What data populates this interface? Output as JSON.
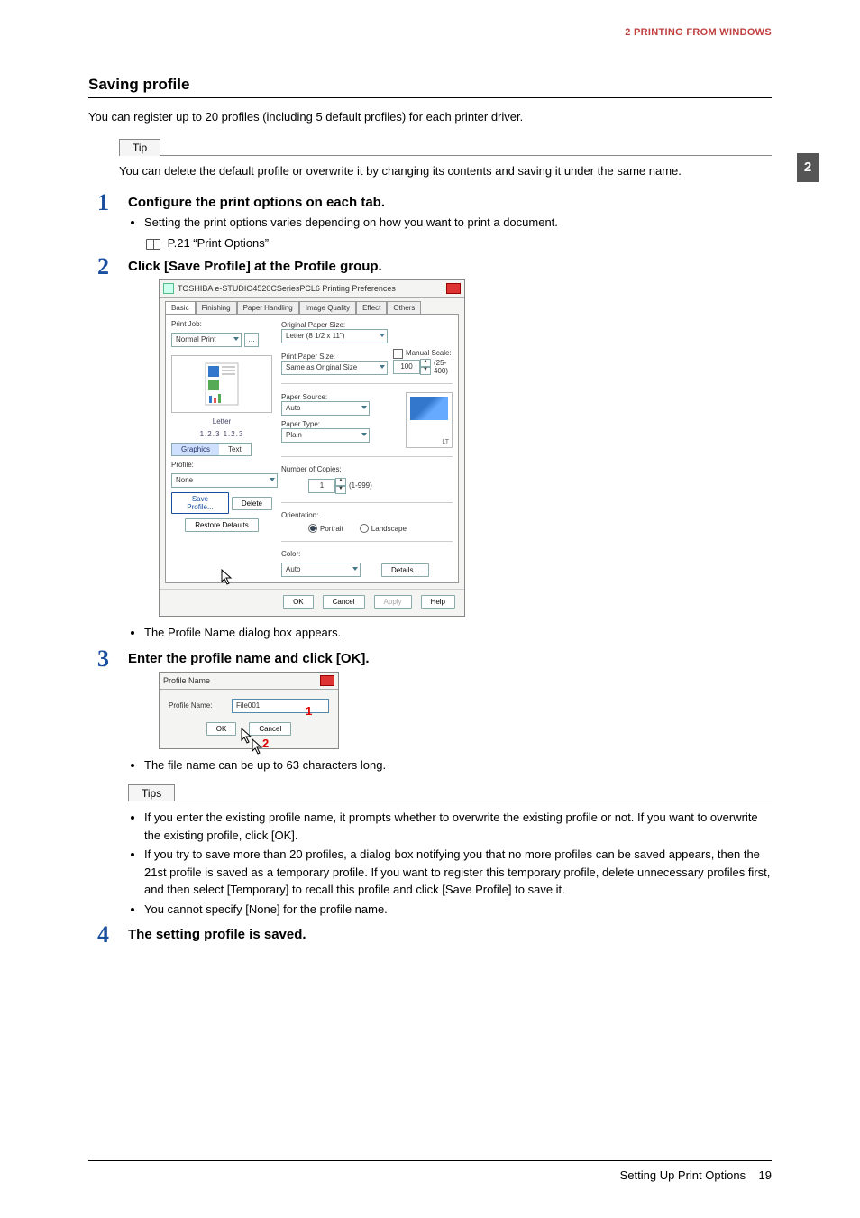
{
  "header": {
    "breadcrumb": "2 PRINTING FROM WINDOWS"
  },
  "thumb": "2",
  "section_title": "Saving profile",
  "intro": "You can register up to 20 profiles (including 5 default profiles) for each printer driver.",
  "tip": {
    "label": "Tip",
    "text": "You can delete the default profile or overwrite it by changing its contents and saving it under the same name."
  },
  "steps": {
    "s1": {
      "num": "1",
      "title": "Configure the print options on each tab.",
      "bullets": [
        "Setting the print options varies depending on how you want to print a document."
      ],
      "ref": "P.21 “Print Options”"
    },
    "s2": {
      "num": "2",
      "title": "Click [Save Profile] at the Profile group.",
      "note": "The Profile Name dialog box appears."
    },
    "s3": {
      "num": "3",
      "title": "Enter the profile name and click [OK].",
      "note": "The file name can be up to 63 characters long."
    },
    "s4": {
      "num": "4",
      "title": "The setting profile is saved."
    }
  },
  "tips2": {
    "label": "Tips",
    "items": [
      "If you enter the existing profile name, it prompts whether to overwrite the existing profile or not.  If you want to overwrite the existing profile, click [OK].",
      "If you try to save more than 20 profiles, a dialog box notifying you that no more profiles can be saved appears, then the 21st profile is saved as a temporary profile. If you want to register this temporary profile, delete unnecessary profiles first, and then select [Temporary] to recall this profile and click [Save Profile] to save it.",
      "You cannot specify [None] for the profile name."
    ]
  },
  "dlg1": {
    "title": "TOSHIBA e-STUDIO4520CSeriesPCL6 Printing Preferences",
    "tabs": [
      "Basic",
      "Finishing",
      "Paper Handling",
      "Image Quality",
      "Effect",
      "Others"
    ],
    "print_job_label": "Print Job:",
    "print_job_value": "Normal Print",
    "letter_caption": "Letter",
    "pages_caption": "1.2.3        1.2.3",
    "graphics_btn": "Graphics",
    "text_btn": "Text",
    "profile_label": "Profile:",
    "profile_value": "None",
    "save_profile_btn": "Save Profile...",
    "delete_btn": "Delete",
    "restore_btn": "Restore Defaults",
    "orig_size_label": "Original Paper Size:",
    "orig_size_value": "Letter (8 1/2 x 11\")",
    "print_size_label": "Print Paper Size:",
    "print_size_value": "Same as Original Size",
    "manual_scale_label": "Manual Scale:",
    "manual_scale_value": "100",
    "manual_scale_range": "(25-400)",
    "paper_source_label": "Paper Source:",
    "paper_source_value": "Auto",
    "paper_type_label": "Paper Type:",
    "paper_type_value": "Plain",
    "copies_label": "Number of Copies:",
    "copies_value": "1",
    "copies_range": "(1-999)",
    "orientation_label": "Orientation:",
    "portrait": "Portrait",
    "landscape": "Landscape",
    "color_label": "Color:",
    "color_value": "Auto",
    "details_btn": "Details...",
    "lt": "LT",
    "ok": "OK",
    "cancel": "Cancel",
    "apply": "Apply",
    "help": "Help"
  },
  "dlg2": {
    "title": "Profile Name",
    "field_label": "Profile Name:",
    "field_value": "File001",
    "ok": "OK",
    "cancel": "Cancel",
    "marker1": "1",
    "marker2": "2"
  },
  "footer": {
    "left": "Setting Up Print Options",
    "page": "19"
  }
}
